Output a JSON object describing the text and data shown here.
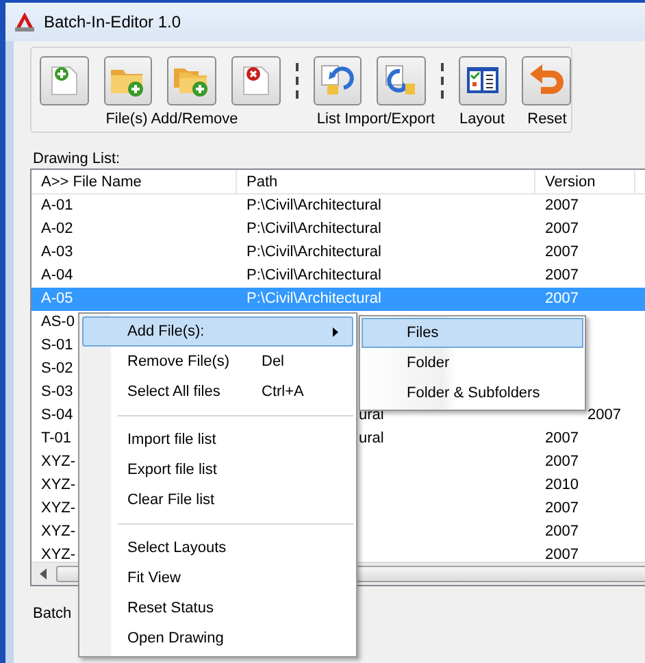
{
  "window": {
    "title": "Batch-In-Editor 1.0"
  },
  "toolbar": {
    "buttons": [
      {
        "kind": "file-add"
      },
      {
        "kind": "folder-add"
      },
      {
        "kind": "folders-add"
      },
      {
        "kind": "file-remove"
      },
      {
        "kind": "separator"
      },
      {
        "kind": "list-import"
      },
      {
        "kind": "list-export"
      },
      {
        "kind": "separator"
      },
      {
        "kind": "layout"
      },
      {
        "kind": "reset"
      }
    ],
    "labels": [
      "File(s) Add/Remove",
      "List Import/Export",
      "Layout",
      "Reset"
    ]
  },
  "drawing_list": {
    "title": "Drawing List:",
    "columns": [
      "A>> File Name",
      "Path",
      "Version"
    ],
    "rows": [
      {
        "file_name": "A-01",
        "path": "P:\\Civil\\Architectural",
        "version": "2007",
        "selected": false
      },
      {
        "file_name": "A-02",
        "path": "P:\\Civil\\Architectural",
        "version": "2007",
        "selected": false
      },
      {
        "file_name": "A-03",
        "path": "P:\\Civil\\Architectural",
        "version": "2007",
        "selected": false
      },
      {
        "file_name": "A-04",
        "path": "P:\\Civil\\Architectural",
        "version": "2007",
        "selected": false
      },
      {
        "file_name": "A-05",
        "path": "P:\\Civil\\Architectural",
        "version": "2007",
        "selected": true
      },
      {
        "file_name": "AS-0",
        "selected": false
      },
      {
        "file_name": "S-01",
        "selected": false
      },
      {
        "file_name": "S-02",
        "selected": false
      },
      {
        "file_name": "S-03",
        "selected": false
      },
      {
        "file_name": "S-04",
        "path": "ural",
        "version": "2007",
        "selected": false
      },
      {
        "file_name": "T-01",
        "path": "ural",
        "version": "2007",
        "selected": false
      },
      {
        "file_name": "XYZ-",
        "version": "2007",
        "selected": false
      },
      {
        "file_name": "XYZ-",
        "version": "2010",
        "selected": false
      },
      {
        "file_name": "XYZ-",
        "version": "2007",
        "selected": false
      },
      {
        "file_name": "XYZ-",
        "version": "2007",
        "selected": false
      },
      {
        "file_name": "XYZ-",
        "version": "2007",
        "selected": false
      }
    ]
  },
  "batch_group": {
    "title": "Batch"
  },
  "context_menu": {
    "items": [
      {
        "kind": "item",
        "label": "Add File(s):",
        "submenu": true,
        "selected": true
      },
      {
        "kind": "item",
        "label": "Remove File(s)",
        "shortcut": "Del",
        "submenu": false,
        "selected": false
      },
      {
        "kind": "item",
        "label": "Select All  files",
        "shortcut": "Ctrl+A",
        "submenu": false,
        "selected": false
      },
      {
        "kind": "separator"
      },
      {
        "kind": "item",
        "label": "Import file list",
        "submenu": false,
        "selected": false
      },
      {
        "kind": "item",
        "label": "Export file list",
        "submenu": false,
        "selected": false
      },
      {
        "kind": "item",
        "label": "Clear File list",
        "submenu": false,
        "selected": false
      },
      {
        "kind": "separator"
      },
      {
        "kind": "item",
        "label": "Select Layouts",
        "submenu": false,
        "selected": false
      },
      {
        "kind": "item",
        "label": "Fit View",
        "submenu": false,
        "selected": false
      },
      {
        "kind": "item",
        "label": "Reset Status",
        "submenu": false,
        "selected": false
      },
      {
        "kind": "item",
        "label": "Open Drawing",
        "submenu": false,
        "selected": false
      }
    ],
    "submenu": [
      {
        "label": "Files",
        "selected": true
      },
      {
        "label": "Folder",
        "selected": false
      },
      {
        "label": "Folder & Subfolders",
        "selected": false
      }
    ]
  }
}
